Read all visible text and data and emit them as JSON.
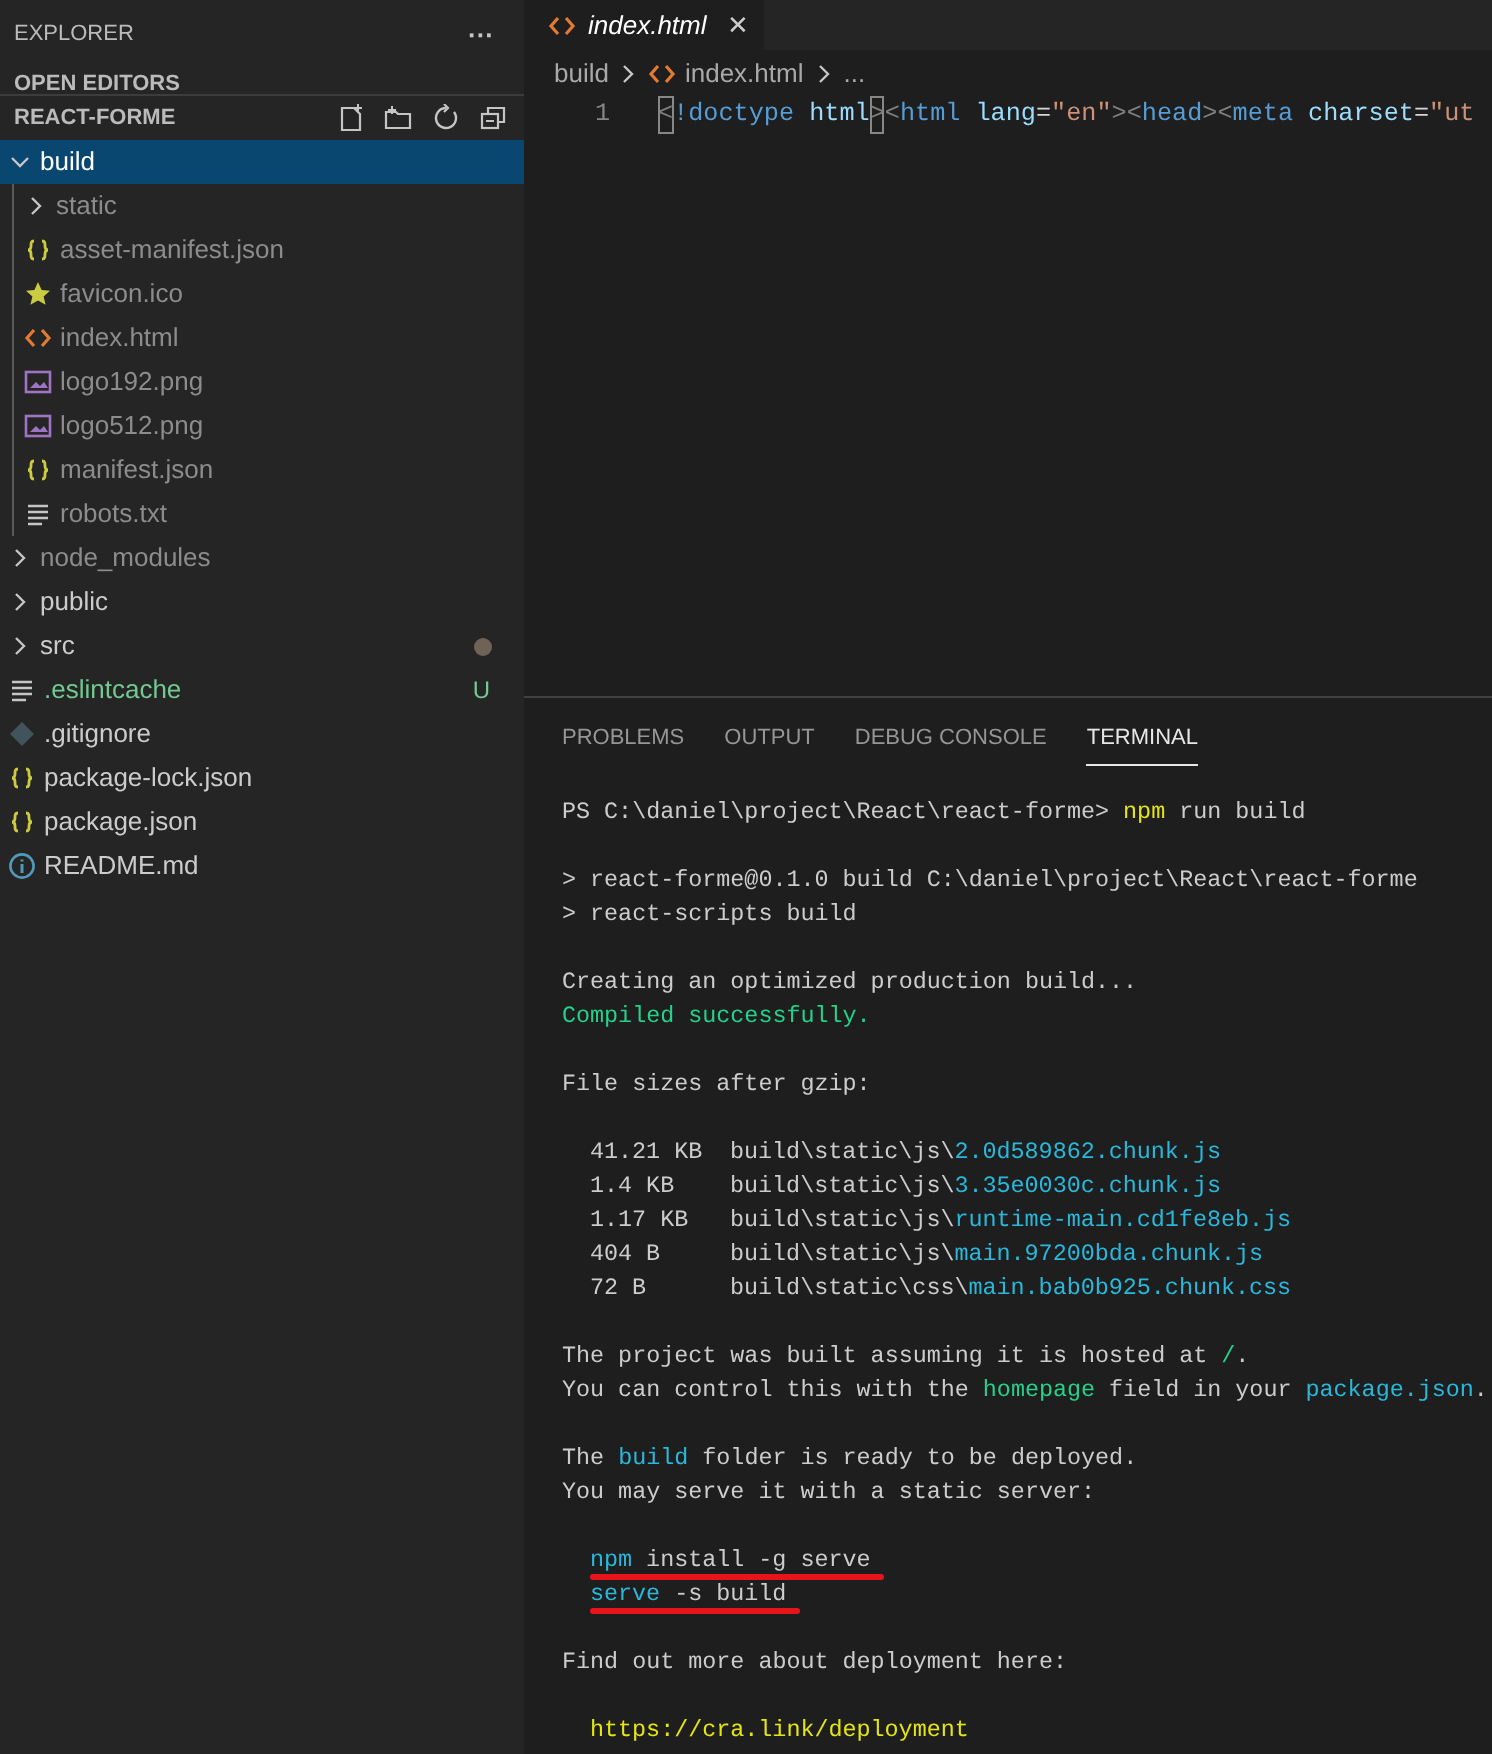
{
  "sidebar": {
    "title": "EXPLORER",
    "more": "···",
    "open_editors": "OPEN EDITORS",
    "project": "REACT-FORME",
    "tree": [
      {
        "name": "build",
        "kind": "folder",
        "expanded": true,
        "selected": true,
        "children": [
          {
            "name": "static",
            "kind": "folder",
            "expanded": false,
            "selected": false,
            "ignored": true
          },
          {
            "name": "asset-manifest.json",
            "kind": "json",
            "selected": false,
            "ignored": true
          },
          {
            "name": "favicon.ico",
            "kind": "star",
            "selected": false,
            "ignored": true
          },
          {
            "name": "index.html",
            "kind": "html",
            "selected": false,
            "ignored": true
          },
          {
            "name": "logo192.png",
            "kind": "image",
            "selected": false,
            "ignored": true
          },
          {
            "name": "logo512.png",
            "kind": "image",
            "selected": false,
            "ignored": true
          },
          {
            "name": "manifest.json",
            "kind": "json",
            "selected": false,
            "ignored": true
          },
          {
            "name": "robots.txt",
            "kind": "text",
            "selected": false,
            "ignored": true
          }
        ]
      },
      {
        "name": "node_modules",
        "kind": "folder",
        "expanded": false,
        "selected": false,
        "ignored": true
      },
      {
        "name": "public",
        "kind": "folder",
        "expanded": false,
        "selected": false
      },
      {
        "name": "src",
        "kind": "folder",
        "expanded": false,
        "selected": false,
        "modified": true
      },
      {
        "name": ".eslintcache",
        "kind": "text",
        "selected": false,
        "untracked": true,
        "status": "U"
      },
      {
        "name": ".gitignore",
        "kind": "git",
        "selected": false
      },
      {
        "name": "package-lock.json",
        "kind": "json",
        "selected": false
      },
      {
        "name": "package.json",
        "kind": "json",
        "selected": false
      },
      {
        "name": "README.md",
        "kind": "info",
        "selected": false
      }
    ]
  },
  "editor": {
    "tabs": [
      {
        "label": "index.html",
        "selected": true,
        "close": "✕"
      }
    ],
    "breadcrumb": [
      "build",
      "index.html",
      "..."
    ],
    "lines": [
      {
        "number": "1",
        "tokens": [
          {
            "text": "<",
            "kind": "punct",
            "bracket_match": true
          },
          {
            "text": "!doctype",
            "kind": "tag"
          },
          {
            "text": " html",
            "kind": "attr"
          },
          {
            "text": ">",
            "kind": "punct",
            "bracket_match": true
          },
          {
            "text": "<",
            "kind": "punct"
          },
          {
            "text": "html",
            "kind": "tag"
          },
          {
            "text": " lang",
            "kind": "attr"
          },
          {
            "text": "=",
            "kind": "plain"
          },
          {
            "text": "\"en\"",
            "kind": "string"
          },
          {
            "text": ">",
            "kind": "punct"
          },
          {
            "text": "<",
            "kind": "punct"
          },
          {
            "text": "head",
            "kind": "tag"
          },
          {
            "text": ">",
            "kind": "punct"
          },
          {
            "text": "<",
            "kind": "punct"
          },
          {
            "text": "meta",
            "kind": "tag"
          },
          {
            "text": " charset",
            "kind": "attr"
          },
          {
            "text": "=",
            "kind": "plain"
          },
          {
            "text": "\"ut",
            "kind": "string"
          }
        ]
      }
    ]
  },
  "panel": {
    "tabs": [
      {
        "label": "PROBLEMS",
        "selected": false
      },
      {
        "label": "OUTPUT",
        "selected": false
      },
      {
        "label": "DEBUG CONSOLE",
        "selected": false
      },
      {
        "label": "TERMINAL",
        "selected": true
      }
    ],
    "terminal_blocks": [
      [
        {
          "kind": "text",
          "segments": [
            {
              "text": "PS C:\\daniel\\project\\React\\react-forme> ",
              "kind": "plain"
            },
            {
              "text": "npm",
              "kind": "yellow"
            },
            {
              "text": " run build",
              "kind": "plain"
            }
          ]
        }
      ],
      [
        {
          "kind": "text",
          "segments": [
            {
              "text": "> react-forme@0.1.0 build C:\\daniel\\project\\React\\react-forme",
              "kind": "plain"
            }
          ]
        },
        {
          "kind": "text",
          "segments": [
            {
              "text": "> react-scripts build",
              "kind": "plain"
            }
          ]
        }
      ],
      [
        {
          "kind": "text",
          "segments": [
            {
              "text": "Creating an optimized production build...",
              "kind": "plain"
            }
          ]
        },
        {
          "kind": "text",
          "segments": [
            {
              "text": "Compiled successfully.",
              "kind": "green"
            }
          ]
        }
      ],
      [
        {
          "kind": "text",
          "segments": [
            {
              "text": "File sizes after gzip:",
              "kind": "plain"
            }
          ]
        }
      ],
      [
        {
          "kind": "file",
          "size": "41.21 KB",
          "segments": [
            {
              "text": "build\\static\\js\\",
              "kind": "plain"
            },
            {
              "text": "2.0d589862.chunk.js",
              "kind": "cyan"
            }
          ]
        },
        {
          "kind": "file",
          "size": "1.4 KB",
          "segments": [
            {
              "text": "build\\static\\js\\",
              "kind": "plain"
            },
            {
              "text": "3.35e0030c.chunk.js",
              "kind": "cyan"
            }
          ]
        },
        {
          "kind": "file",
          "size": "1.17 KB",
          "segments": [
            {
              "text": "build\\static\\js\\",
              "kind": "plain"
            },
            {
              "text": "runtime-main.cd1fe8eb.js",
              "kind": "cyan"
            }
          ]
        },
        {
          "kind": "file",
          "size": "404 B",
          "segments": [
            {
              "text": "build\\static\\js\\",
              "kind": "plain"
            },
            {
              "text": "main.97200bda.chunk.js",
              "kind": "cyan"
            }
          ]
        },
        {
          "kind": "file",
          "size": "72 B",
          "segments": [
            {
              "text": "build\\static\\css\\",
              "kind": "plain"
            },
            {
              "text": "main.bab0b925.chunk.css",
              "kind": "cyan"
            }
          ]
        }
      ],
      [
        {
          "kind": "text",
          "segments": [
            {
              "text": "The project was built assuming it is hosted at ",
              "kind": "plain"
            },
            {
              "text": "/",
              "kind": "green"
            },
            {
              "text": ".",
              "kind": "plain"
            }
          ]
        },
        {
          "kind": "text",
          "segments": [
            {
              "text": "You can control this with the ",
              "kind": "plain"
            },
            {
              "text": "homepage",
              "kind": "green"
            },
            {
              "text": " field in your ",
              "kind": "plain"
            },
            {
              "text": "package.json",
              "kind": "cyan"
            },
            {
              "text": ".",
              "kind": "plain"
            }
          ]
        }
      ],
      [
        {
          "kind": "text",
          "segments": [
            {
              "text": "The ",
              "kind": "plain"
            },
            {
              "text": "build",
              "kind": "cyan"
            },
            {
              "text": " folder is ready to be deployed.",
              "kind": "plain"
            }
          ]
        },
        {
          "kind": "text",
          "segments": [
            {
              "text": "You may serve it with a static server:",
              "kind": "plain"
            }
          ]
        }
      ],
      [
        {
          "kind": "command",
          "underlined": true,
          "segments": [
            {
              "text": "npm",
              "kind": "cyan"
            },
            {
              "text": " install -g serve",
              "kind": "plain"
            }
          ]
        },
        {
          "kind": "command",
          "underlined": true,
          "segments": [
            {
              "text": "serve",
              "kind": "cyan"
            },
            {
              "text": " -s build",
              "kind": "plain"
            }
          ]
        }
      ],
      [
        {
          "kind": "text",
          "segments": [
            {
              "text": "Find out more about deployment here:",
              "kind": "plain"
            }
          ]
        }
      ],
      [
        {
          "kind": "command",
          "segments": [
            {
              "text": "https://cra.link/deployment",
              "kind": "yellow"
            }
          ]
        }
      ]
    ]
  }
}
